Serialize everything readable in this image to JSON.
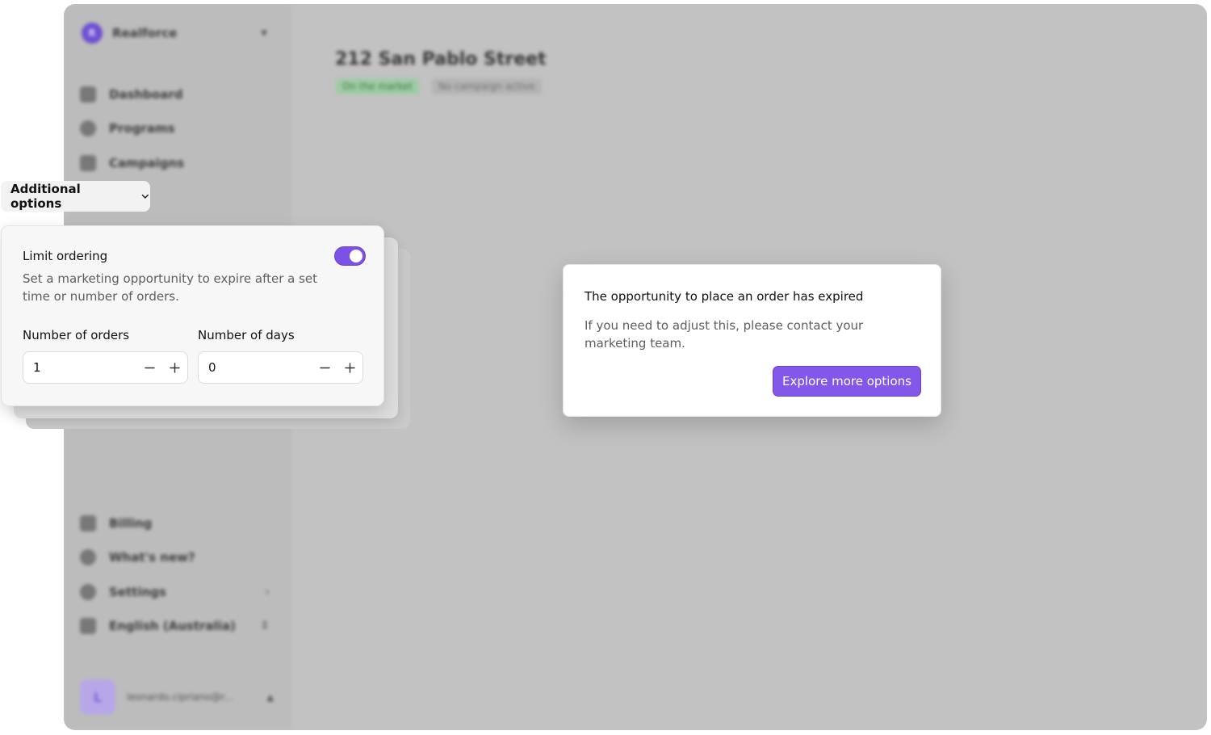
{
  "app": {
    "org_name": "Realforce",
    "org_initial": "R",
    "nav_top": [
      {
        "label": "Dashboard",
        "icon": "dashboard-icon"
      },
      {
        "label": "Programs",
        "icon": "programs-icon"
      },
      {
        "label": "Campaigns",
        "icon": "campaigns-icon"
      }
    ],
    "nav_bottom": [
      {
        "label": "Billing",
        "icon": "billing-icon"
      },
      {
        "label": "What's new?",
        "icon": "share-icon"
      },
      {
        "label": "Settings",
        "icon": "gear-icon"
      },
      {
        "label": "English (Australia)",
        "icon": "language-icon"
      }
    ],
    "user_initial": "L",
    "user_email": "leonardo.cipriano@r...",
    "page_title": "212 San Pablo Street",
    "badge_market": "On the market",
    "badge_campaign": "No campaign active"
  },
  "options": {
    "pill_label": "Additional options"
  },
  "limit_card": {
    "title": "Limit ordering",
    "description": "Set a marketing opportunity to expire after a set time or number of orders.",
    "toggle_on": true,
    "orders_label": "Number of orders",
    "orders_value": "1",
    "days_label": "Number of days",
    "days_value": "0"
  },
  "modal": {
    "title": "The opportunity to place an order has expired",
    "body": "If you need to adjust this, please contact your marketing team.",
    "button_label": "Explore more options"
  },
  "colors": {
    "accent": "#8357ea",
    "toggle": "#7c52e6",
    "backdrop": "#c2c2c2"
  }
}
